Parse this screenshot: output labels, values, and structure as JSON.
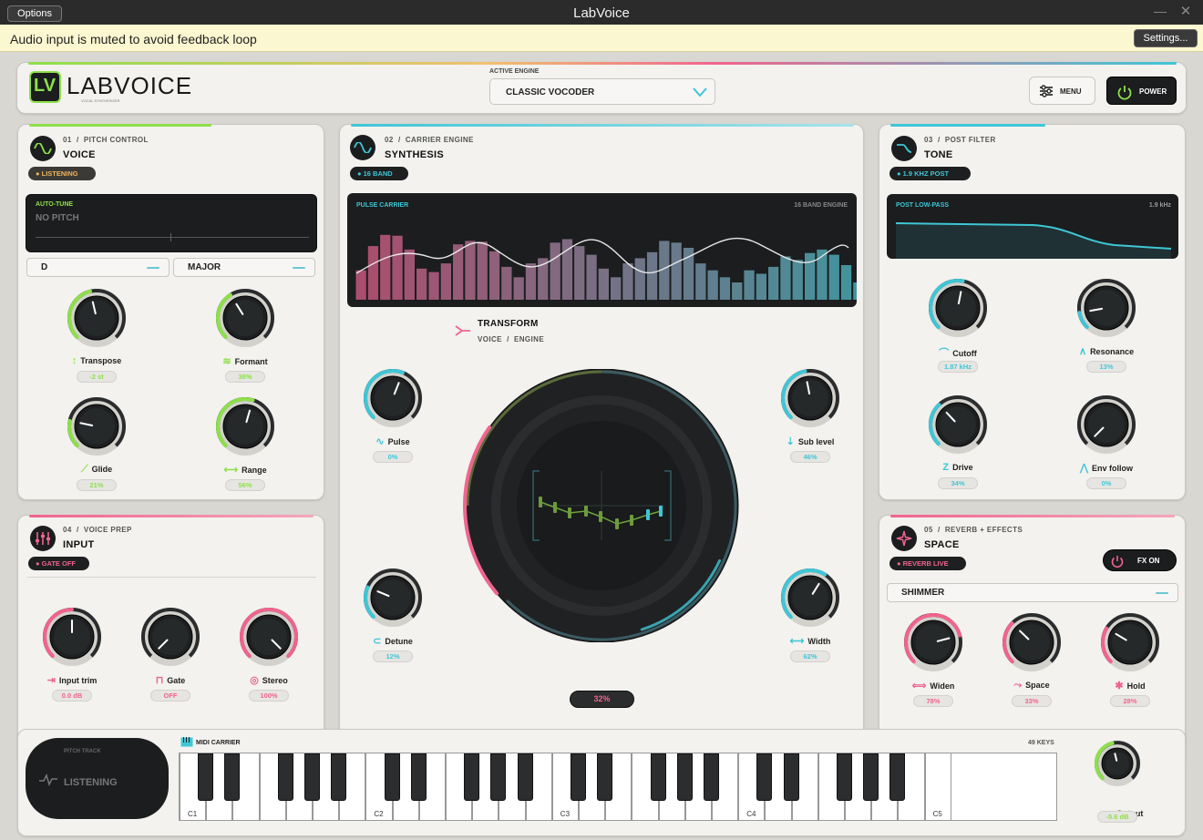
{
  "window": {
    "title": "LabVoice",
    "options_label": "Options",
    "min_glyph": "—",
    "close_glyph": "✕"
  },
  "notice": {
    "text": "Audio input is muted to avoid feedback loop",
    "settings_label": "Settings..."
  },
  "header": {
    "logo_mark": "LV",
    "brand": "LABVOICE",
    "tagline": "VOCAL SYNTHESIZER",
    "engine_label": "ACTIVE ENGINE",
    "engine_value": "CLASSIC VOCODER",
    "menu_label": "MENU",
    "power_label": "POWER"
  },
  "voice": {
    "num": "01",
    "sep": "/",
    "section": "PITCH CONTROL",
    "title": "VOICE",
    "status": "LISTENING",
    "autotune_label": "AUTO-TUNE",
    "pitch_text": "NO PITCH",
    "key": "D",
    "scale": "MAJOR",
    "knobs": [
      {
        "label": "Transpose",
        "value": "-2 st",
        "level": 0.45
      },
      {
        "label": "Formant",
        "value": "38%",
        "level": 0.38
      },
      {
        "label": "Glide",
        "value": "21%",
        "level": 0.21
      },
      {
        "label": "Range",
        "value": "56%",
        "level": 0.56
      }
    ]
  },
  "synth": {
    "num": "02",
    "sep": "/",
    "section": "CARRIER ENGINE",
    "title": "SYNTHESIS",
    "status": "16 BAND",
    "viz_label": "PULSE CARRIER",
    "viz_right": "16 BAND ENGINE",
    "transform_title": "TRANSFORM",
    "transform_sub": "VOICE  /  ENGINE",
    "center_value": "32%",
    "knobs": [
      {
        "label": "Pulse",
        "value": "0%",
        "level": 0.58
      },
      {
        "label": "Sub level",
        "value": "46%",
        "level": 0.46
      },
      {
        "label": "Detune",
        "value": "12%",
        "level": 0.25
      },
      {
        "label": "Width",
        "value": "62%",
        "level": 0.62
      }
    ]
  },
  "tone": {
    "num": "03",
    "sep": "/",
    "section": "POST FILTER",
    "title": "TONE",
    "status": "1.9 KHZ POST",
    "viz_label": "POST LOW-PASS",
    "viz_right": "1.9 kHz",
    "knobs": [
      {
        "label": "Cutoff",
        "value": "1.87 kHz",
        "level": 0.54
      },
      {
        "label": "Resonance",
        "value": "13%",
        "level": 0.13
      },
      {
        "label": "Drive",
        "value": "34%",
        "level": 0.34
      },
      {
        "label": "Env follow",
        "value": "0%",
        "level": 0.0
      }
    ]
  },
  "input": {
    "num": "04",
    "sep": "/",
    "section": "VOICE PREP",
    "title": "INPUT",
    "status": "GATE OFF",
    "knobs": [
      {
        "label": "Input trim",
        "value": "0.0 dB",
        "level": 0.5
      },
      {
        "label": "Gate",
        "value": "OFF",
        "level": 0.0
      },
      {
        "label": "Stereo",
        "value": "100%",
        "level": 1.0
      }
    ]
  },
  "space": {
    "num": "05",
    "sep": "/",
    "section": "REVERB + EFFECTS",
    "title": "SPACE",
    "status": "REVERB LIVE",
    "fx_label": "FX ON",
    "preset": "SHIMMER",
    "knobs": [
      {
        "label": "Widen",
        "value": "78%",
        "level": 0.78
      },
      {
        "label": "Space",
        "value": "33%",
        "level": 0.33
      },
      {
        "label": "Hold",
        "value": "28%",
        "level": 0.28
      }
    ]
  },
  "keyboard": {
    "track_label": "PITCH TRACK",
    "track_status": "LISTENING",
    "midi_label": "MIDI CARRIER",
    "keys_count": "49 KEYS",
    "octaves": [
      "C1",
      "C2",
      "C3",
      "C4",
      "C5"
    ],
    "output_label": "Output",
    "output_value": "-5.6 dB",
    "output_level": 0.45
  },
  "colors": {
    "green": "#8ee04a",
    "cyan": "#3fc6d6",
    "pink": "#f0648e",
    "dark": "#1b1d1e"
  }
}
